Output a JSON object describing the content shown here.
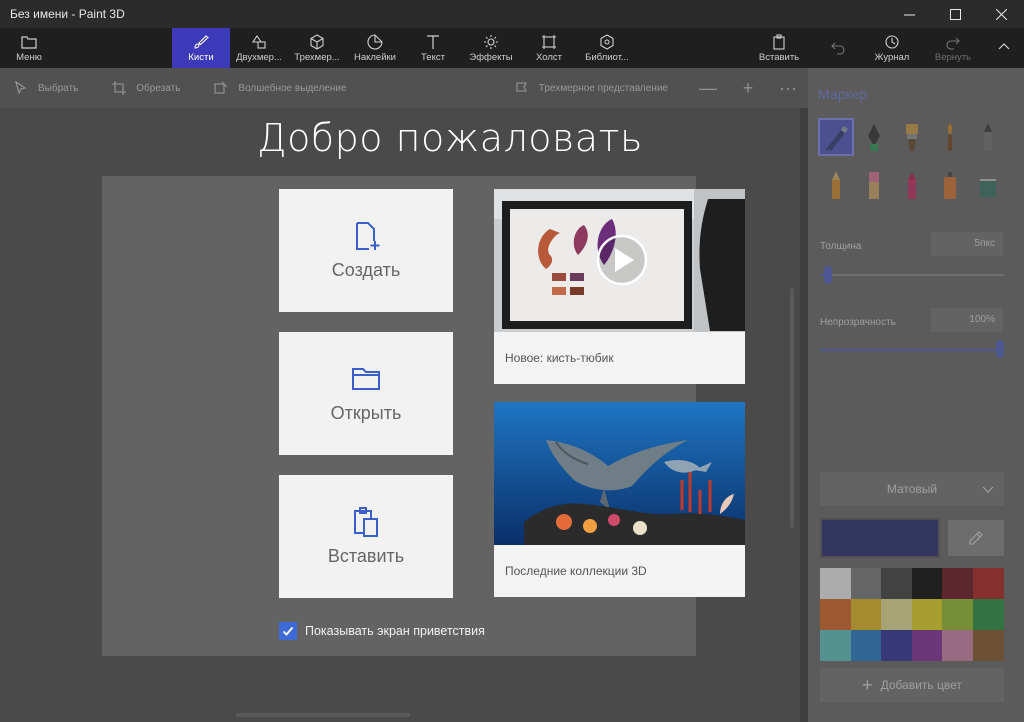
{
  "window": {
    "title": "Без имени - Paint 3D"
  },
  "ribbon": {
    "menu_label": "Меню",
    "tabs": [
      {
        "label": "Кисти",
        "icon": "brush-icon",
        "active": true
      },
      {
        "label": "Двухмер...",
        "icon": "shapes-2d-icon",
        "active": false
      },
      {
        "label": "Трехмер...",
        "icon": "cube-icon",
        "active": false
      },
      {
        "label": "Наклейки",
        "icon": "sticker-icon",
        "active": false
      },
      {
        "label": "Текст",
        "icon": "text-icon",
        "active": false
      },
      {
        "label": "Эффекты",
        "icon": "effects-icon",
        "active": false
      },
      {
        "label": "Холст",
        "icon": "canvas-icon",
        "active": false
      },
      {
        "label": "Библиот...",
        "icon": "library-icon",
        "active": false
      }
    ],
    "paste_label": "Вставить",
    "history_label": "Журнал",
    "redo_label": "Вернуть"
  },
  "toolbar": {
    "select_label": "Выбрать",
    "crop_label": "Обрезать",
    "magic_select_label": "Волшебное выделение",
    "view3d_label": "Трехмерное представление",
    "zoom_out": "—",
    "zoom_in": "+",
    "more": "···"
  },
  "welcome": {
    "title": "Добро пожаловать",
    "create_label": "Создать",
    "open_label": "Открыть",
    "paste_label": "Вставить",
    "tile1_caption": "Новое: кисть-тюбик",
    "tile2_caption": "Последние коллекции 3D",
    "show_welcome_label": "Показывать экран приветствия",
    "show_welcome_checked": true
  },
  "panel": {
    "title": "Маркер",
    "thickness_label": "Толщина",
    "thickness_value": "5пкс",
    "thickness_level": 0.03,
    "opacity_label": "Непрозрачность",
    "opacity_value": "100%",
    "opacity_level": 1.0,
    "finish_label": "Матовый",
    "current_color": "#232a73",
    "add_color_label": "Добавить цвет",
    "palette": [
      "#ffffff",
      "#7f7f7f",
      "#3f3f3f",
      "#000000",
      "#6d0f1b",
      "#b91d1d",
      "#e36b20",
      "#f2c11c",
      "#f5ee9a",
      "#f5e61c",
      "#9dcb2a",
      "#1f9a3e",
      "#5fd0d0",
      "#1f7fd1",
      "#2b2f9e",
      "#8a2aa0",
      "#d98ab0",
      "#8c5a2a"
    ]
  }
}
